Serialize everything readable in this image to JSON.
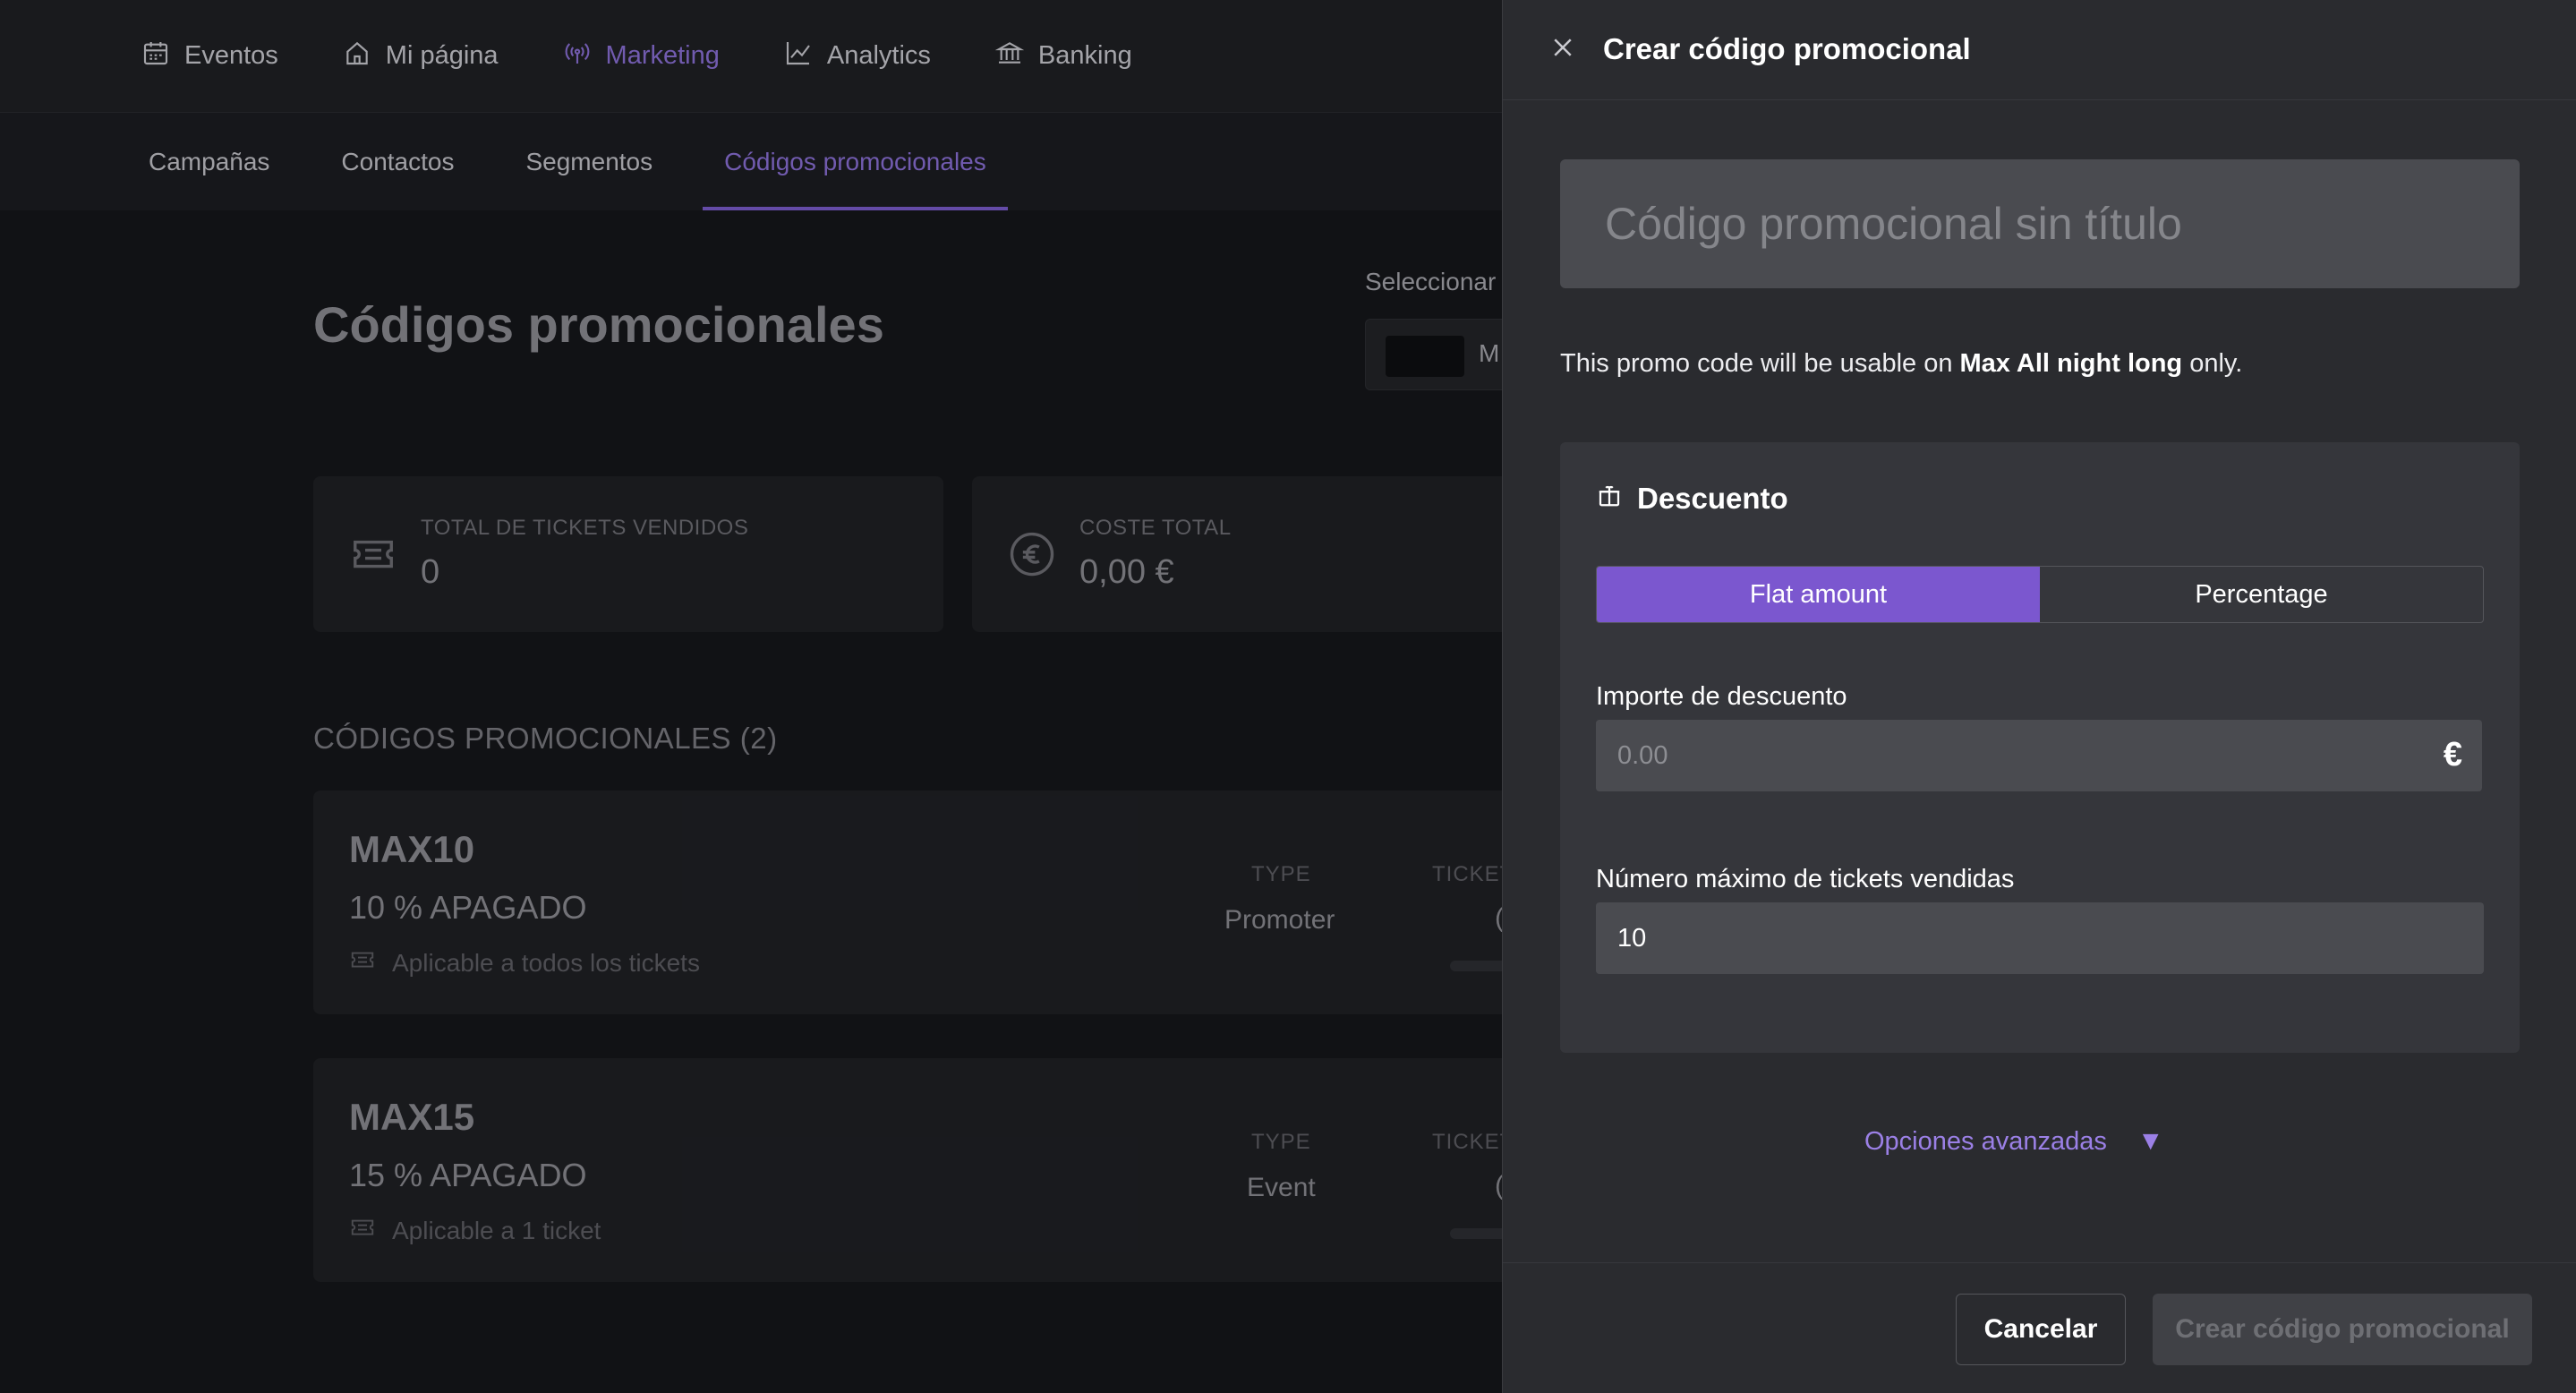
{
  "topnav": {
    "items": [
      {
        "label": "Eventos",
        "icon": "calendar-icon"
      },
      {
        "label": "Mi página",
        "icon": "home-icon"
      },
      {
        "label": "Marketing",
        "icon": "broadcast-icon",
        "active": true
      },
      {
        "label": "Analytics",
        "icon": "chart-line-icon"
      },
      {
        "label": "Banking",
        "icon": "bank-icon"
      }
    ]
  },
  "subnav": {
    "tabs": [
      {
        "label": "Campañas"
      },
      {
        "label": "Contactos"
      },
      {
        "label": "Segmentos"
      },
      {
        "label": "Códigos promocionales",
        "active": true
      }
    ]
  },
  "main": {
    "title": "Códigos promocionales",
    "select_label": "Seleccionar",
    "select_value": "M",
    "stats": [
      {
        "label": "TOTAL DE TICKETS VENDIDOS",
        "value": "0",
        "icon": "ticket-icon"
      },
      {
        "label": "COSTE TOTAL",
        "value": "0,00 €",
        "icon": "euro-icon"
      }
    ],
    "section_title": "CÓDIGOS PROMOCIONALES (2)",
    "promos": [
      {
        "code": "MAX10",
        "off": "10 % APAGADO",
        "applicable": "Aplicable a todos los tickets",
        "type_label": "TYPE",
        "type": "Promoter",
        "ticket_label": "TICKET",
        "ticket_value": "("
      },
      {
        "code": "MAX15",
        "off": "15 % APAGADO",
        "applicable": "Aplicable a 1 ticket",
        "type_label": "TYPE",
        "type": "Event",
        "ticket_label": "TICKET",
        "ticket_value": "("
      }
    ]
  },
  "drawer": {
    "title": "Crear código promocional",
    "title_placeholder": "Código promocional sin título",
    "usable_prefix": "This promo code will be usable on ",
    "usable_event": "Max All night long",
    "usable_suffix": " only.",
    "discount": {
      "heading": "Descuento",
      "options": [
        "Flat amount",
        "Percentage"
      ],
      "selected": "Flat amount",
      "amount_label": "Importe de descuento",
      "amount_placeholder": "0.00",
      "currency": "€",
      "max_label": "Número máximo de tickets vendidas",
      "max_value": "10"
    },
    "advanced": "Opciones avanzadas",
    "cancel": "Cancelar",
    "create": "Crear código promocional"
  },
  "colors": {
    "accent": "#7b57cf",
    "accent_text": "#9b80e6",
    "drawer_bg": "#2a2b2f",
    "page_bg": "#15161a"
  }
}
